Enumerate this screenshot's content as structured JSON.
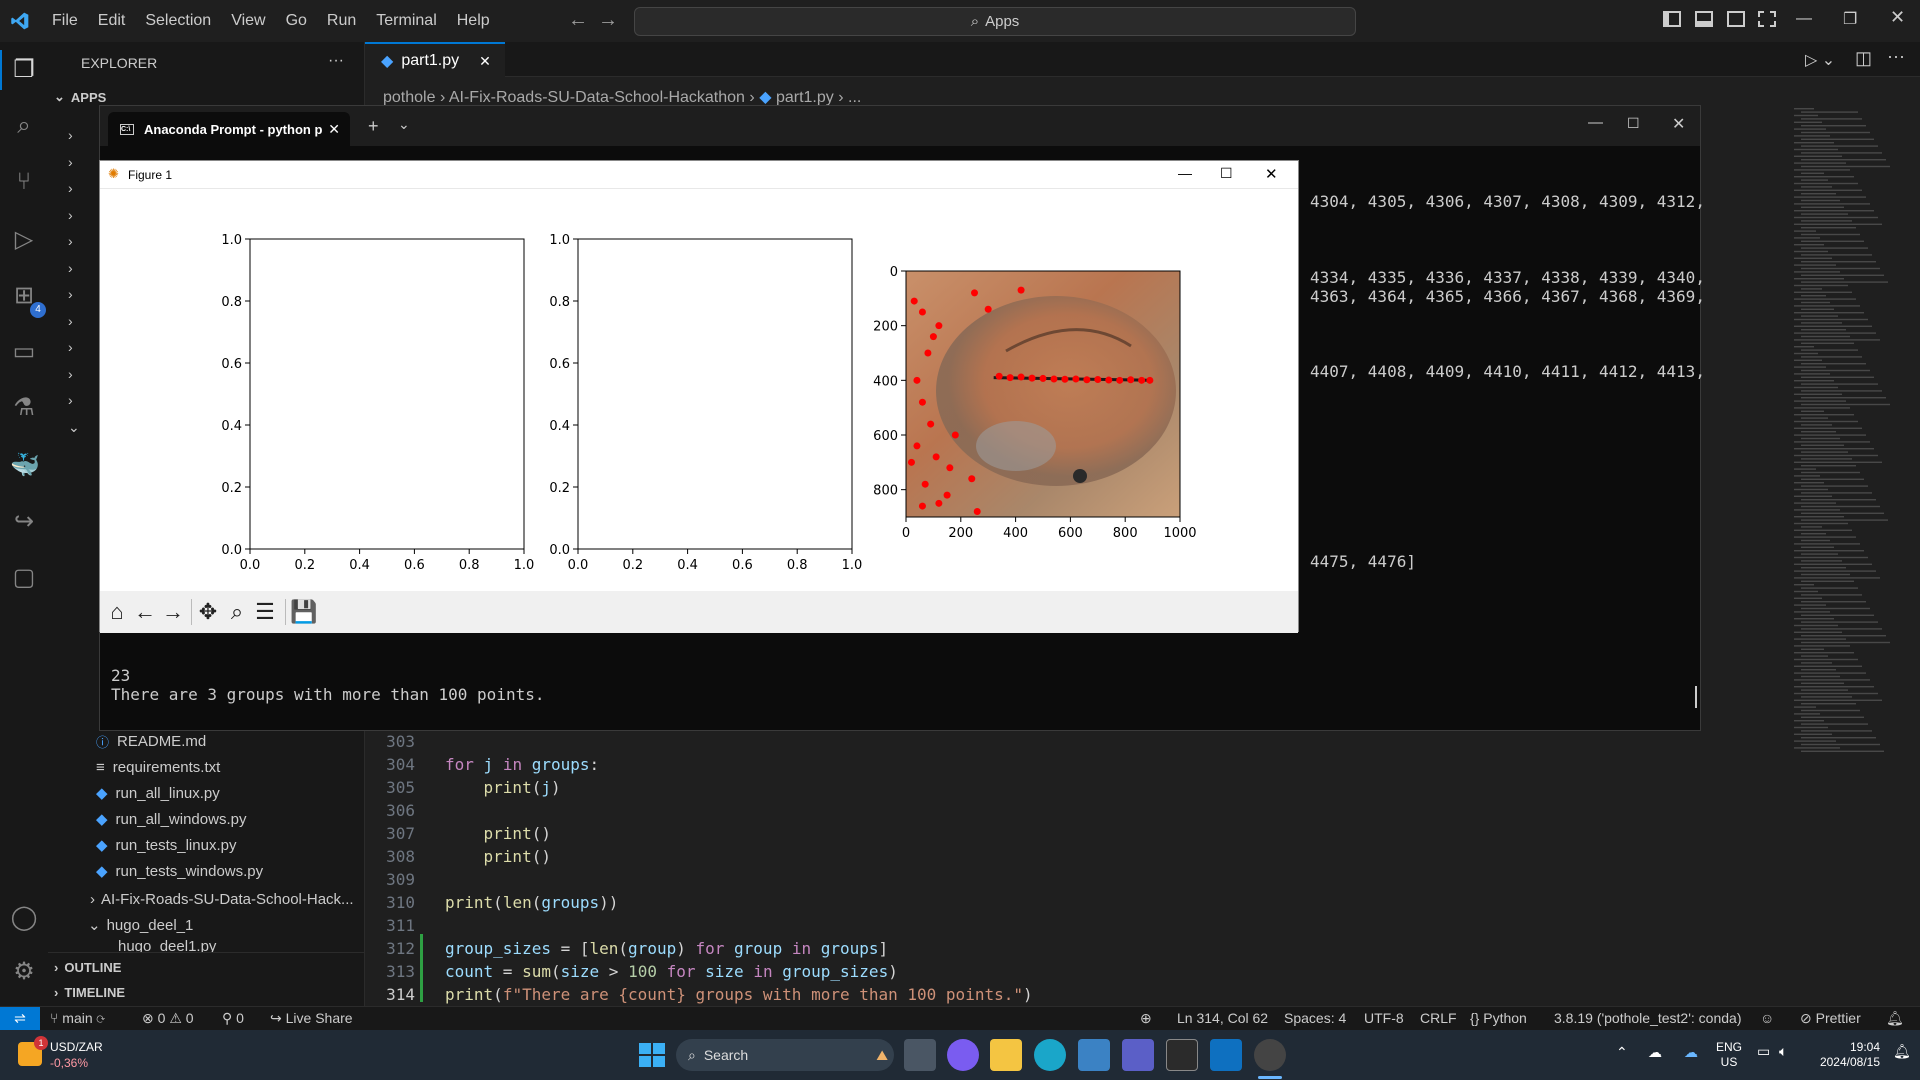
{
  "menu": [
    "File",
    "Edit",
    "Selection",
    "View",
    "Go",
    "Run",
    "Terminal",
    "Help"
  ],
  "command_center": "Apps",
  "sidebar": {
    "title": "EXPLORER",
    "section": "APPS",
    "files": [
      "README.md",
      "requirements.txt",
      "run_all_linux.py",
      "run_all_windows.py",
      "run_tests_linux.py",
      "run_tests_windows.py"
    ],
    "folder1": "AI-Fix-Roads-SU-Data-School-Hack...",
    "folder2": "hugo_deel_1",
    "partial_file": "hugo_deel1.py",
    "outline": "OUTLINE",
    "timeline": "TIMELINE"
  },
  "editor": {
    "tab": "part1.py",
    "breadcrumb": [
      "pothole",
      "AI-Fix-Roads-SU-Data-School-Hackathon",
      "part1.py",
      "..."
    ],
    "lines": [
      {
        "n": "303",
        "code": ""
      },
      {
        "n": "304",
        "code": "for j in groups:"
      },
      {
        "n": "305",
        "code": "    print(j)"
      },
      {
        "n": "306",
        "code": ""
      },
      {
        "n": "307",
        "code": "    print()"
      },
      {
        "n": "308",
        "code": "    print()"
      },
      {
        "n": "309",
        "code": ""
      },
      {
        "n": "310",
        "code": "print(len(groups))"
      },
      {
        "n": "311",
        "code": ""
      },
      {
        "n": "312",
        "code": "group_sizes = [len(group) for group in groups]"
      },
      {
        "n": "313",
        "code": "count = sum(size > 100 for size in group_sizes)"
      },
      {
        "n": "314",
        "code": "print(f\"There are {count} groups with more than 100 points.\")"
      }
    ]
  },
  "terminal": {
    "tab_title": "Anaconda Prompt - python  p",
    "output_right": [
      "4304, 4305, 4306, 4307, 4308, 4309, 4312,",
      "4334, 4335, 4336, 4337, 4338, 4339, 4340,",
      "4363, 4364, 4365, 4366, 4367, 4368, 4369,",
      "4407, 4408, 4409, 4410, 4411, 4412, 4413,",
      "4475, 4476]"
    ],
    "output_bottom": [
      "23",
      "There are 3 groups with more than 100 points."
    ]
  },
  "figure": {
    "title": "Figure 1"
  },
  "chart_data": [
    {
      "type": "line",
      "series": [],
      "xlim": [
        0.0,
        1.0
      ],
      "ylim": [
        0.0,
        1.0
      ],
      "xticks": [
        "0.0",
        "0.2",
        "0.4",
        "0.6",
        "0.8",
        "1.0"
      ],
      "yticks": [
        "0.0",
        "0.2",
        "0.4",
        "0.6",
        "0.8",
        "1.0"
      ]
    },
    {
      "type": "line",
      "series": [],
      "xlim": [
        0.0,
        1.0
      ],
      "ylim": [
        0.0,
        1.0
      ],
      "xticks": [
        "0.0",
        "0.2",
        "0.4",
        "0.6",
        "0.8",
        "1.0"
      ],
      "yticks": [
        "0.0",
        "0.2",
        "0.4",
        "0.6",
        "0.8",
        "1.0"
      ]
    },
    {
      "type": "scatter",
      "background": "image",
      "xlim": [
        0,
        1000
      ],
      "ylim": [
        900,
        0
      ],
      "xticks": [
        "0",
        "200",
        "400",
        "600",
        "800",
        "1000"
      ],
      "yticks": [
        "0",
        "200",
        "400",
        "600",
        "800"
      ],
      "points_color": "#ff0000",
      "line": {
        "x": [
          320,
          900
        ],
        "y": [
          390,
          400
        ]
      },
      "points": [
        [
          340,
          385
        ],
        [
          380,
          390
        ],
        [
          420,
          388
        ],
        [
          460,
          392
        ],
        [
          500,
          393
        ],
        [
          540,
          395
        ],
        [
          580,
          396
        ],
        [
          620,
          395
        ],
        [
          660,
          398
        ],
        [
          700,
          397
        ],
        [
          740,
          399
        ],
        [
          780,
          400
        ],
        [
          820,
          398
        ],
        [
          860,
          400
        ],
        [
          890,
          400
        ],
        [
          30,
          110
        ],
        [
          60,
          150
        ],
        [
          120,
          200
        ],
        [
          250,
          80
        ],
        [
          300,
          140
        ],
        [
          420,
          70
        ],
        [
          80,
          300
        ],
        [
          40,
          400
        ],
        [
          60,
          480
        ],
        [
          90,
          560
        ],
        [
          40,
          640
        ],
        [
          110,
          680
        ],
        [
          160,
          720
        ],
        [
          70,
          780
        ],
        [
          150,
          820
        ],
        [
          240,
          760
        ],
        [
          60,
          860
        ],
        [
          120,
          850
        ],
        [
          260,
          880
        ],
        [
          20,
          700
        ],
        [
          180,
          600
        ],
        [
          100,
          240
        ]
      ]
    }
  ],
  "statusbar": {
    "branch": "main",
    "errors": "0",
    "warnings": "0",
    "ports": "0",
    "live_share": "Live Share",
    "position": "Ln 314, Col 62",
    "spaces": "Spaces: 4",
    "encoding": "UTF-8",
    "eol": "CRLF",
    "language": "Python",
    "interpreter": "3.8.19 ('pothole_test2': conda)",
    "prettier": "Prettier"
  },
  "taskbar": {
    "ticker": "USD/ZAR",
    "ticker_change": "-0,36%",
    "search": "Search",
    "lang": "ENG",
    "region": "US",
    "time": "19:04",
    "date": "2024/08/15"
  },
  "colors": {
    "accent": "#0078d4",
    "badge": "#2f6fd0"
  }
}
